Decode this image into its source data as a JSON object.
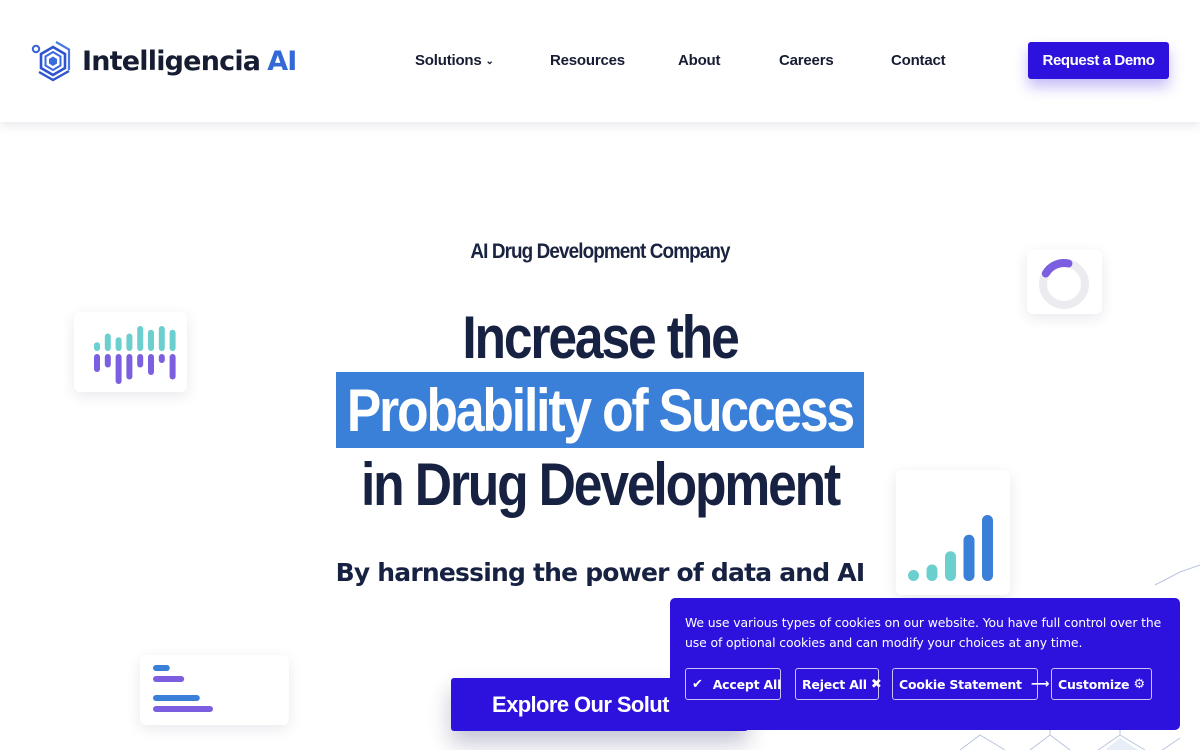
{
  "header": {
    "logo_name": "Intelligencia",
    "logo_suffix": "AI",
    "nav": [
      {
        "label": "Solutions",
        "has_dropdown": true
      },
      {
        "label": "Resources"
      },
      {
        "label": "About"
      },
      {
        "label": "Careers"
      },
      {
        "label": "Contact"
      }
    ],
    "cta_label": "Request a Demo"
  },
  "hero": {
    "eyebrow": "AI Drug Development Company",
    "headline_line1": "Increase the",
    "headline_highlight": "Probability of Success",
    "headline_line3": "in Drug Development",
    "subheadline": "By harnessing the power of data and AI",
    "cta_label": "Explore Our Solutions"
  },
  "decor": {
    "wave_bars": {
      "up": [
        0.35,
        0.7,
        0.55,
        0.7,
        1.0,
        0.85,
        1.0,
        0.85
      ],
      "down": [
        0.6,
        0.45,
        1.0,
        0.85,
        0.45,
        0.7,
        0.3,
        0.85
      ]
    },
    "ring_progress": 0.2,
    "signal_bars": [
      0.1,
      0.25,
      0.45,
      0.7,
      1.0
    ],
    "hbars": [
      {
        "value": 0.28,
        "color": "blue"
      },
      {
        "value": 0.52,
        "color": "purple"
      },
      {
        "value": 0.78,
        "color": "blue"
      },
      {
        "value": 1.0,
        "color": "purple"
      }
    ]
  },
  "cookie_banner": {
    "message": "We use various types of cookies on our website. You have full control over the use of optional cookies and can modify your choices at any time.",
    "buttons": {
      "accept": {
        "label": "Accept All",
        "icon": "check-icon"
      },
      "reject": {
        "label": "Reject All",
        "icon": "x-icon"
      },
      "statement": {
        "label": "Cookie Statement",
        "icon": "arrow-right-icon"
      },
      "customize": {
        "label": "Customize",
        "icon": "gear-icon"
      }
    }
  },
  "colors": {
    "brand_primary": "#2d12de",
    "highlight_blue": "#3a7fd8",
    "text_dark": "#172141",
    "teal": "#6ccfcf",
    "purple": "#7b5fe0",
    "blue": "#3a7fd8"
  }
}
